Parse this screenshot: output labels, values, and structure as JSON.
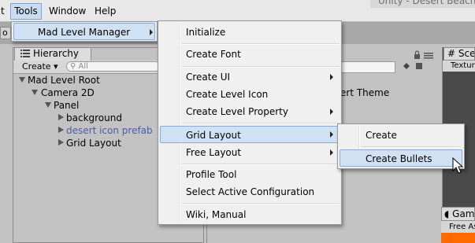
{
  "menubar": {
    "items": [
      "t",
      "Tools",
      "Window",
      "Help"
    ],
    "title_fragment": "Unity - Desert Beach"
  },
  "hierarchy": {
    "tab_label": "Hierarchy",
    "create_label": "Create ▾",
    "search_placeholder": "All",
    "tree": [
      {
        "label": "Mad Level Root",
        "expanded": true,
        "selected_color": false
      },
      {
        "label": "Camera 2D",
        "expanded": true,
        "selected_color": false
      },
      {
        "label": "Panel",
        "expanded": true,
        "selected_color": false
      },
      {
        "label": "background",
        "expanded": false,
        "selected_color": false
      },
      {
        "label": "desert icon prefab",
        "expanded": false,
        "selected_color": true
      },
      {
        "label": "Grid Layout",
        "expanded": false,
        "selected_color": false
      }
    ]
  },
  "inspector": {
    "theme_text": "ert Theme"
  },
  "scene": {
    "tab_label": "Scene",
    "texture_label": "Textured"
  },
  "game": {
    "tab_label": "Game",
    "free_label": "Free Aspect"
  },
  "menus": {
    "level1": {
      "items": [
        {
          "label": "Mad Level Manager",
          "submenu": true,
          "highlighted": true
        }
      ]
    },
    "level2": {
      "items": [
        {
          "label": "Initialize",
          "submenu": false
        },
        {
          "label": "Create Font",
          "submenu": false
        },
        {
          "label": "Create UI",
          "submenu": true
        },
        {
          "label": "Create Level Icon",
          "submenu": false
        },
        {
          "label": "Create Level Property",
          "submenu": true
        },
        {
          "label": "Grid Layout",
          "submenu": true,
          "highlighted": true
        },
        {
          "label": "Free Layout",
          "submenu": true
        },
        {
          "label": "Profile Tool",
          "submenu": false
        },
        {
          "label": "Select Active Configuration",
          "submenu": false
        },
        {
          "label": "Wiki, Manual",
          "submenu": false
        }
      ]
    },
    "level3": {
      "items": [
        {
          "label": "Create",
          "submenu": false
        },
        {
          "label": "Create Bullets",
          "submenu": false,
          "highlighted": true
        }
      ]
    }
  },
  "colors": {
    "highlight_bg": "#cfe1f3",
    "highlight_border": "#84acdd",
    "prefab_text": "#4b5dab",
    "accent_orange": "#ff6a00"
  },
  "icons": [
    "list-icon",
    "search-icon",
    "lock-icon",
    "menu-icon",
    "mouse-cursor-icon",
    "hash-icon",
    "pacman-icon"
  ]
}
